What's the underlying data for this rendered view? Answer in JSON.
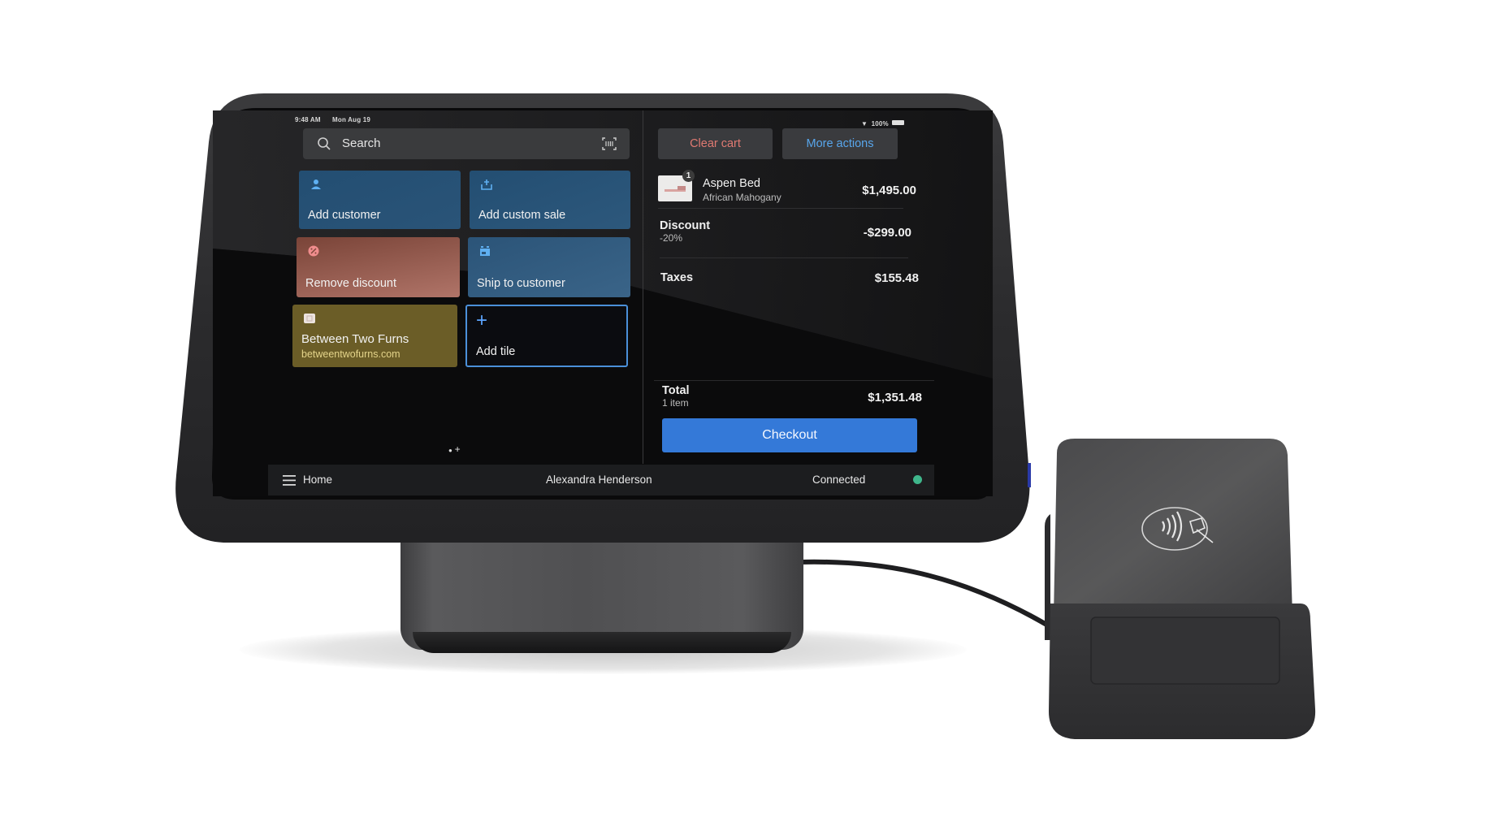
{
  "status_bar": {
    "time": "9:48 AM",
    "date": "Mon Aug 19",
    "battery": "100%",
    "wifi_icon": "wifi-icon",
    "battery_icon": "battery-icon"
  },
  "search": {
    "placeholder": "Search",
    "icon": "search-icon",
    "scan_icon": "barcode-scan-icon"
  },
  "tiles": [
    {
      "label": "Add customer",
      "icon": "person-icon",
      "color": "#234e72"
    },
    {
      "label": "Add custom sale",
      "icon": "tray-add-icon",
      "color": "#234e72"
    },
    {
      "label": "Remove discount",
      "icon": "discount-badge-icon",
      "color": "#9a5a4e"
    },
    {
      "label": "Ship to customer",
      "icon": "shipping-box-icon",
      "color": "#2f5a7e"
    },
    {
      "label": "Between Two Furns",
      "sublabel": "betweentwofurns.com",
      "icon": "brand-logo-icon",
      "color": "#6b5d27"
    },
    {
      "label": "Add tile",
      "icon": "plus-icon",
      "color": "#4b90d9"
    }
  ],
  "pager": {
    "dot": "●",
    "add": "+"
  },
  "cart": {
    "clear_label": "Clear cart",
    "more_label": "More actions",
    "items": [
      {
        "name": "Aspen Bed",
        "variant": "African Mahogany",
        "qty": "1",
        "price": "$1,495.00"
      }
    ],
    "discount": {
      "label": "Discount",
      "detail": "-20%",
      "amount": "-$299.00"
    },
    "taxes": {
      "label": "Taxes",
      "amount": "$155.48"
    },
    "total": {
      "label": "Total",
      "count": "1 item",
      "amount": "$1,351.48"
    },
    "checkout_label": "Checkout"
  },
  "bottom_bar": {
    "menu_label": "Home",
    "user": "Alexandra Henderson",
    "connection": "Connected",
    "connection_color": "#3fb68b"
  },
  "colors": {
    "accent": "#3479d8",
    "danger_text": "#e07a72",
    "link_text": "#58a6ec"
  }
}
